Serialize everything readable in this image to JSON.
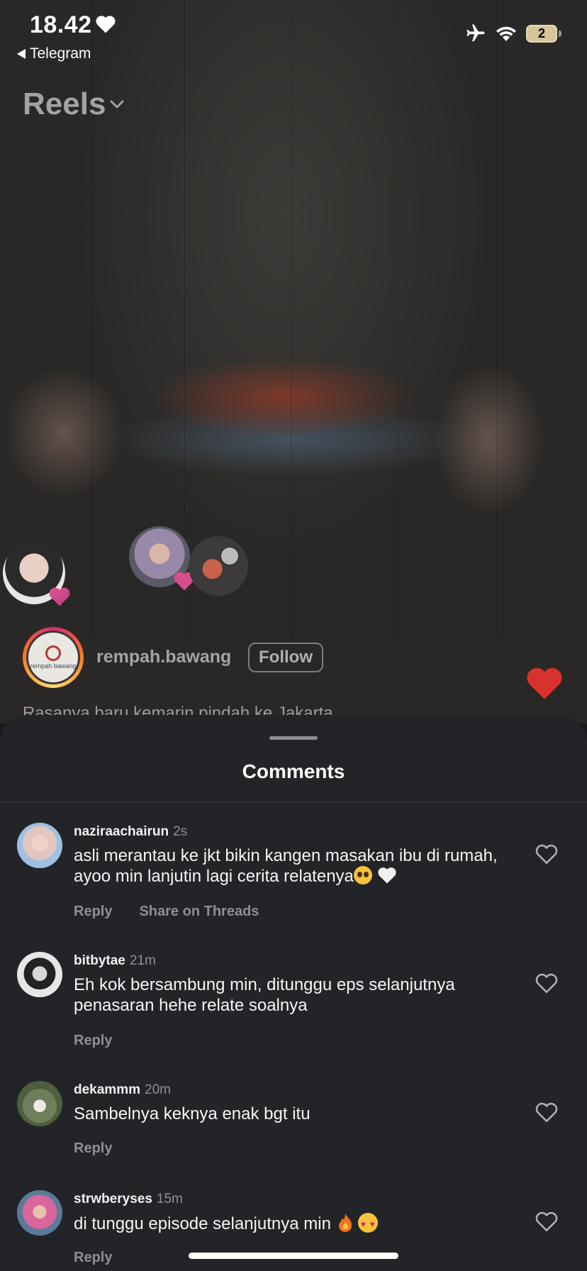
{
  "status_bar": {
    "time": "18.42",
    "back_app": "Telegram",
    "battery": "2"
  },
  "header": {
    "title": "Reels"
  },
  "reel": {
    "account": "rempah.bawang",
    "logo_text": "rempah bawang",
    "follow_label": "Follow",
    "caption": "Rasanya baru kemarin pindah ke Jakarta"
  },
  "comments_sheet": {
    "title": "Comments",
    "comments": [
      {
        "user": "naziraachairun",
        "time": "2s",
        "text": "asli merantau ke jkt bikin kangen masakan ibu di rumah, ayoo min lanjutin lagi cerita relatenya",
        "reply": "Reply",
        "share": "Share on Threads"
      },
      {
        "user": "bitbytae",
        "time": "21m",
        "text": "Eh kok bersambung min, ditunggu eps selanjutnya penasaran hehe relate soalnya",
        "reply": "Reply"
      },
      {
        "user": "dekammm",
        "time": "20m",
        "text": "Sambelnya keknya enak bgt itu",
        "reply": "Reply"
      },
      {
        "user": "strwberyses",
        "time": "15m",
        "text": "di tunggu episode selanjutnya min",
        "reply": "Reply"
      }
    ]
  },
  "colors": {
    "sheet_bg": "#232428",
    "like_red": "#d8322e",
    "muted_text": "#8e8e93"
  }
}
